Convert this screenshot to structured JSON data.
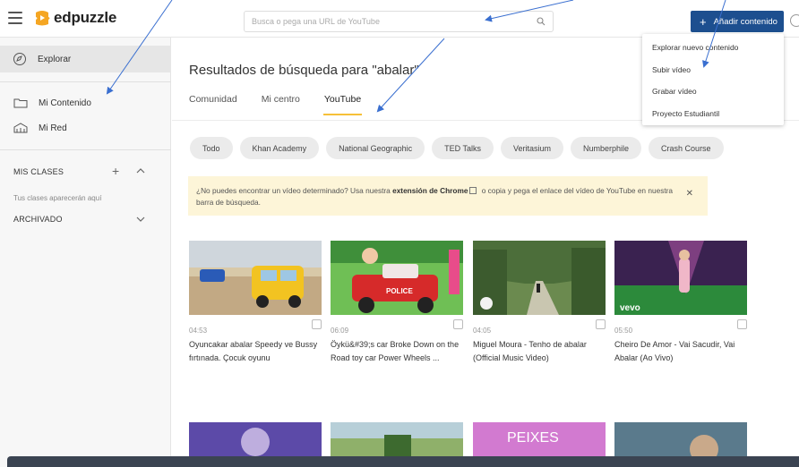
{
  "app": {
    "logo_text": "edpuzzle"
  },
  "search": {
    "placeholder": "Busca o pega una URL de YouTube"
  },
  "header": {
    "add_label": "Añadir contenido"
  },
  "sidebar": {
    "explore": "Explorar",
    "my_content": "Mi Contenido",
    "my_network": "Mi Red",
    "classes_header": "MIS CLASES",
    "classes_note": "Tus clases aparecerán aquí",
    "archived_header": "ARCHIVADO"
  },
  "main": {
    "title": "Resultados de búsqueda para \"abalar\"",
    "tabs": [
      {
        "label": "Comunidad"
      },
      {
        "label": "Mi centro"
      },
      {
        "label": "YouTube"
      }
    ],
    "channels": [
      "Todo",
      "Khan Academy",
      "National Geographic",
      "TED Talks",
      "Veritasium",
      "Numberphile",
      "Crash Course"
    ],
    "banner": {
      "text_before": "¿No puedes encontrar un vídeo determinado? Usa nuestra ",
      "link": "extensión de Chrome",
      "text_after": " o copia y pega el enlace del vídeo de YouTube en nuestra barra de búsqueda.",
      "close": "✕"
    },
    "videos": [
      {
        "duration": "04:53",
        "title": "Oyuncakar abalar Speedy ve Bussy fırtınada. Çocuk oyunu"
      },
      {
        "duration": "06:09",
        "title": "Öykü&#39;s car Broke Down on the Road toy car Power Wheels ..."
      },
      {
        "duration": "04:05",
        "title": "Miguel Moura - Tenho de abalar (Official Music Video)"
      },
      {
        "duration": "05:50",
        "title": "Cheiro De Amor - Vai Sacudir, Vai Abalar (Ao Vivo)"
      }
    ],
    "thumb_badges": {
      "police": "POLICE",
      "vevo": "vevo",
      "peixes": "PEIXES"
    }
  },
  "dropdown": {
    "items": [
      "Explorar nuevo contenido",
      "Subir vídeo",
      "Grabar vídeo",
      "Proyecto Estudiantil"
    ]
  },
  "colors": {
    "accent": "#1d4f8f",
    "tab_underline": "#f6c038",
    "annotation_arrow": "#3a6fd0"
  }
}
